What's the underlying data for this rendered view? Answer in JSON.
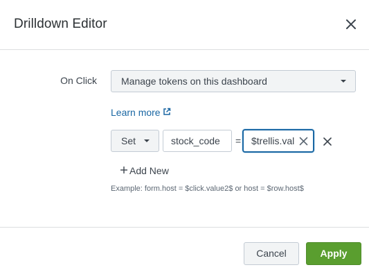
{
  "dialog": {
    "title": "Drilldown Editor",
    "close_icon": "close-icon"
  },
  "on_click": {
    "label": "On Click",
    "selected": "Manage tokens on this dashboard"
  },
  "learn_more": {
    "label": "Learn more",
    "icon": "external-link-icon"
  },
  "token_row": {
    "action": "Set",
    "token_name": "stock_code",
    "equals": "=",
    "token_value": "$trellis.val",
    "clear_icon": "clear-icon",
    "remove_icon": "remove-icon"
  },
  "add_new": {
    "label": "Add New",
    "icon": "plus-icon"
  },
  "example": "Example: form.host = $click.value2$ or host = $row.host$",
  "footer": {
    "cancel_label": "Cancel",
    "apply_label": "Apply"
  },
  "colors": {
    "link": "#1a67a3",
    "focus_border": "#1a67a3",
    "primary": "#5a9e2f"
  }
}
